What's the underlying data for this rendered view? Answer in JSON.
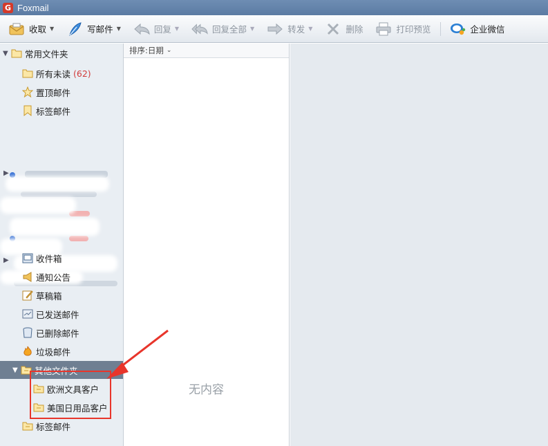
{
  "app": {
    "title": "Foxmail"
  },
  "toolbar": {
    "receive": "收取",
    "compose": "写邮件",
    "reply": "回复",
    "reply_all": "回复全部",
    "forward": "转发",
    "delete": "删除",
    "print_preview": "打印预览",
    "wecom": "企业微信"
  },
  "sidebar": {
    "common_folders": "常用文件夹",
    "all_unread": "所有未读",
    "all_unread_count": "(62)",
    "pinned": "置顶邮件",
    "tagged": "标签邮件",
    "inbox": "收件箱",
    "notices": "通知公告",
    "drafts": "草稿箱",
    "sent": "已发送邮件",
    "deleted": "已删除邮件",
    "spam": "垃圾邮件",
    "other_folders": "其他文件夹",
    "sub_europe": "欧洲文具客户",
    "sub_usa": "美国日用品客户",
    "tagged_bottom": "标签邮件"
  },
  "list": {
    "sort_label": "排序:日期",
    "empty": "无内容"
  },
  "colors": {
    "titlebar": "#5b7ba3",
    "selected": "#6f7f92",
    "annotation": "#e8352b",
    "unread_count": "#d13b3b"
  }
}
